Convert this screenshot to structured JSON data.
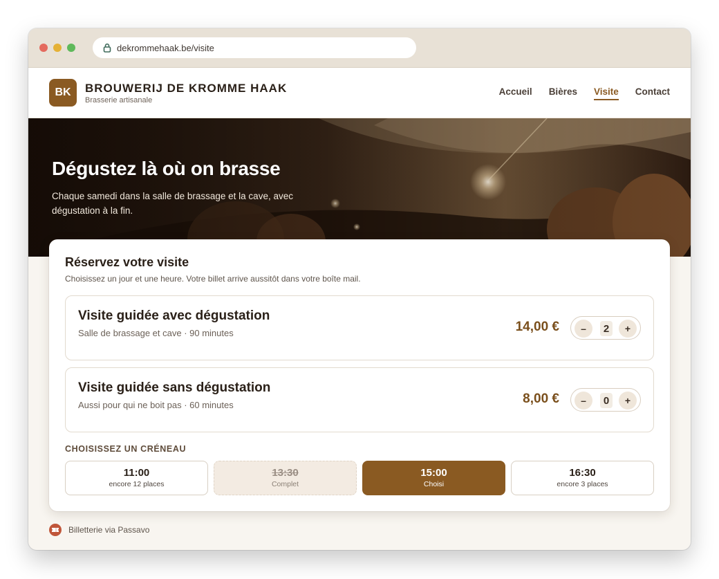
{
  "browser": {
    "url": "dekrommehaak.be/visite"
  },
  "site": {
    "logo": "BK",
    "name": "BROUWERIJ DE KROMME HAAK",
    "tagline": "Brasserie artisanale",
    "nav": [
      {
        "label": "Accueil",
        "active": false
      },
      {
        "label": "Bières",
        "active": false
      },
      {
        "label": "Visite",
        "active": true
      },
      {
        "label": "Contact",
        "active": false
      }
    ]
  },
  "hero": {
    "title": "Dégustez là où on brasse",
    "subtitle": "Chaque samedi dans la salle de brassage et la cave, avec dégustation à la fin."
  },
  "booking": {
    "title": "Réservez votre visite",
    "subtitle": "Choisissez un jour et une heure. Votre billet arrive aussitôt dans votre boîte mail.",
    "tickets": [
      {
        "name": "Visite guidée avec dégustation",
        "description": "Salle de brassage et cave · 90 minutes",
        "price": "14,00 €",
        "quantity": "2"
      },
      {
        "name": "Visite guidée sans dégustation",
        "description": "Aussi pour qui ne boit pas · 60 minutes",
        "price": "8,00 €",
        "quantity": "0"
      }
    ],
    "stepper": {
      "minus": "–",
      "plus": "+"
    },
    "slots_label": "CHOISISSEZ UN CRÉNEAU",
    "slots": [
      {
        "time": "11:00",
        "note": "encore 12 places",
        "state": "available"
      },
      {
        "time": "13:30",
        "note": "Complet",
        "state": "full"
      },
      {
        "time": "15:00",
        "note": "Choisi",
        "state": "selected"
      },
      {
        "time": "16:30",
        "note": "encore 3 places",
        "state": "available"
      }
    ]
  },
  "footer": {
    "text": "Billetterie via Passavo"
  },
  "colors": {
    "accent": "#8a5a22",
    "price": "#7a4f1c",
    "chrome": "#e8e1d6",
    "page_bg": "#f8f5f0"
  }
}
